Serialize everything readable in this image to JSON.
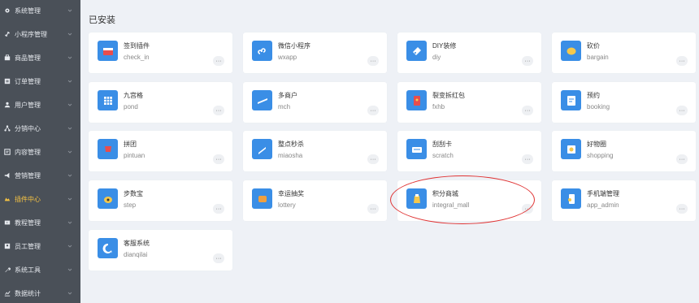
{
  "sidebar": {
    "items": [
      {
        "label": "系统管理",
        "icon": "gear-icon",
        "active": false
      },
      {
        "label": "小程序管理",
        "icon": "link-icon",
        "active": false
      },
      {
        "label": "商品管理",
        "icon": "goods-icon",
        "active": false
      },
      {
        "label": "订单管理",
        "icon": "order-icon",
        "active": false
      },
      {
        "label": "用户管理",
        "icon": "user-icon",
        "active": false
      },
      {
        "label": "分销中心",
        "icon": "share-icon",
        "active": false
      },
      {
        "label": "内容管理",
        "icon": "content-icon",
        "active": false
      },
      {
        "label": "营销管理",
        "icon": "marketing-icon",
        "active": false
      },
      {
        "label": "插件中心",
        "icon": "plugin-icon",
        "active": true
      },
      {
        "label": "教程管理",
        "icon": "tutorial-icon",
        "active": false
      },
      {
        "label": "员工管理",
        "icon": "staff-icon",
        "active": false
      },
      {
        "label": "系统工具",
        "icon": "wrench-icon",
        "active": false
      },
      {
        "label": "数据统计",
        "icon": "stats-icon",
        "active": false
      }
    ]
  },
  "main": {
    "section_title": "已安装",
    "more_label": "···",
    "plugins": [
      {
        "name": "签到插件",
        "code": "check_in",
        "icon": "calendar-icon"
      },
      {
        "name": "微信小程序",
        "code": "wxapp",
        "icon": "wxapp-icon"
      },
      {
        "name": "DIY装修",
        "code": "diy",
        "icon": "diy-icon"
      },
      {
        "name": "砍价",
        "code": "bargain",
        "icon": "bargain-icon"
      },
      {
        "name": "九宫格",
        "code": "pond",
        "icon": "grid-icon"
      },
      {
        "name": "多商户",
        "code": "mch",
        "icon": "shop-icon"
      },
      {
        "name": "裂变拆红包",
        "code": "fxhb",
        "icon": "red-packet-icon"
      },
      {
        "name": "预约",
        "code": "booking",
        "icon": "booking-icon"
      },
      {
        "name": "拼团",
        "code": "pintuan",
        "icon": "group-buy-icon"
      },
      {
        "name": "整点秒杀",
        "code": "miaosha",
        "icon": "flash-sale-icon"
      },
      {
        "name": "刮刮卡",
        "code": "scratch",
        "icon": "scratch-card-icon"
      },
      {
        "name": "好物圈",
        "code": "shopping",
        "icon": "good-items-icon"
      },
      {
        "name": "步数宝",
        "code": "step",
        "icon": "step-icon"
      },
      {
        "name": "幸运抽奖",
        "code": "lottery",
        "icon": "lottery-icon"
      },
      {
        "name": "积分商城",
        "code": "integral_mall",
        "icon": "integral-mall-icon"
      },
      {
        "name": "手机端管理",
        "code": "app_admin",
        "icon": "mobile-admin-icon"
      },
      {
        "name": "客服系统",
        "code": "dianqilai",
        "icon": "customer-service-icon"
      }
    ]
  },
  "colors": {
    "sidebar_bg": "#4a5058",
    "sidebar_text": "#e6e9ee",
    "sidebar_active": "#f6c343",
    "icon_bg": "#3a8ee6",
    "highlight": "#e03434",
    "page_bg": "#eef1f6"
  }
}
